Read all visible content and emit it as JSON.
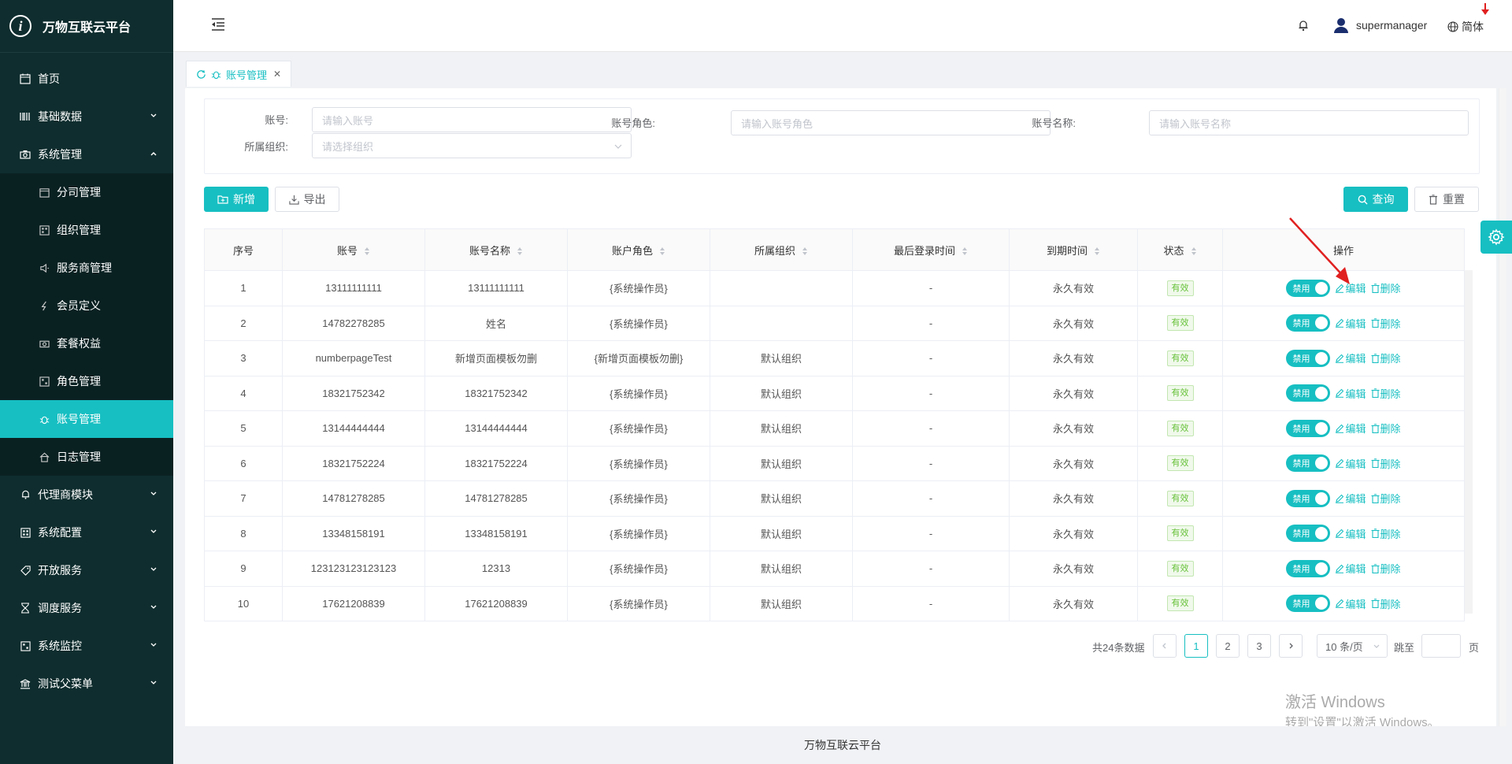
{
  "app": {
    "title": "万物互联云平台"
  },
  "sidebar": {
    "items": [
      {
        "label": "首页",
        "icon": "calendar-icon"
      },
      {
        "label": "基础数据",
        "icon": "barcode-icon"
      },
      {
        "label": "系统管理",
        "icon": "camera-icon"
      },
      {
        "label": "代理商模块",
        "icon": "bell-icon"
      },
      {
        "label": "系统配置",
        "icon": "grid-icon"
      },
      {
        "label": "开放服务",
        "icon": "tag-icon"
      },
      {
        "label": "调度服务",
        "icon": "hourglass-icon"
      },
      {
        "label": "系统监控",
        "icon": "grid-icon"
      },
      {
        "label": "测试父菜单",
        "icon": "bank-icon"
      }
    ],
    "sub_items": [
      {
        "label": "分司管理",
        "icon": "calendar-icon"
      },
      {
        "label": "组织管理",
        "icon": "grid-icon"
      },
      {
        "label": "服务商管理",
        "icon": "speaker-icon"
      },
      {
        "label": "会员定义",
        "icon": "bolt-icon"
      },
      {
        "label": "套餐权益",
        "icon": "camera-icon"
      },
      {
        "label": "角色管理",
        "icon": "grid-icon"
      },
      {
        "label": "账号管理",
        "icon": "bug-icon"
      },
      {
        "label": "日志管理",
        "icon": "home-icon"
      }
    ]
  },
  "topbar": {
    "user": "supermanager",
    "lang": "简体"
  },
  "tabs": [
    {
      "label": "账号管理"
    }
  ],
  "search": {
    "account_label": "账号:",
    "account_placeholder": "请输入账号",
    "role_label": "账号角色:",
    "role_placeholder": "请输入账号角色",
    "name_label": "账号名称:",
    "name_placeholder": "请输入账号名称",
    "org_label": "所属组织:",
    "org_placeholder": "请选择组织"
  },
  "toolbar": {
    "add": "新增",
    "export": "导出",
    "query": "查询",
    "reset": "重置"
  },
  "table": {
    "columns": [
      "序号",
      "账号",
      "账号名称",
      "账户角色",
      "所属组织",
      "最后登录时间",
      "到期时间",
      "状态",
      "操作"
    ],
    "rows": [
      {
        "no": "1",
        "account": "13111111111",
        "name": "13111111111",
        "role": "{系统操作员}",
        "org": "",
        "last_login": "-",
        "expire": "永久有效",
        "status": "有效"
      },
      {
        "no": "2",
        "account": "14782278285",
        "name": "姓名",
        "role": "{系统操作员}",
        "org": "",
        "last_login": "-",
        "expire": "永久有效",
        "status": "有效"
      },
      {
        "no": "3",
        "account": "numberpageTest",
        "name": "新增页面模板勿删",
        "role": "{新增页面模板勿删}",
        "org": "默认组织",
        "last_login": "-",
        "expire": "永久有效",
        "status": "有效"
      },
      {
        "no": "4",
        "account": "18321752342",
        "name": "18321752342",
        "role": "{系统操作员}",
        "org": "默认组织",
        "last_login": "-",
        "expire": "永久有效",
        "status": "有效"
      },
      {
        "no": "5",
        "account": "13144444444",
        "name": "13144444444",
        "role": "{系统操作员}",
        "org": "默认组织",
        "last_login": "-",
        "expire": "永久有效",
        "status": "有效"
      },
      {
        "no": "6",
        "account": "18321752224",
        "name": "18321752224",
        "role": "{系统操作员}",
        "org": "默认组织",
        "last_login": "-",
        "expire": "永久有效",
        "status": "有效"
      },
      {
        "no": "7",
        "account": "14781278285",
        "name": "14781278285",
        "role": "{系统操作员}",
        "org": "默认组织",
        "last_login": "-",
        "expire": "永久有效",
        "status": "有效"
      },
      {
        "no": "8",
        "account": "13348158191",
        "name": "13348158191",
        "role": "{系统操作员}",
        "org": "默认组织",
        "last_login": "-",
        "expire": "永久有效",
        "status": "有效"
      },
      {
        "no": "9",
        "account": "123123123123123",
        "name": "12313",
        "role": "{系统操作员}",
        "org": "默认组织",
        "last_login": "-",
        "expire": "永久有效",
        "status": "有效"
      },
      {
        "no": "10",
        "account": "17621208839",
        "name": "17621208839",
        "role": "{系统操作员}",
        "org": "默认组织",
        "last_login": "-",
        "expire": "永久有效",
        "status": "有效"
      }
    ],
    "toggle_label": "禁用",
    "edit_label": "编辑",
    "delete_label": "删除"
  },
  "pagination": {
    "total": "共24条数据",
    "pages": [
      "1",
      "2",
      "3"
    ],
    "current": "1",
    "page_size": "10 条/页",
    "jump_label": "跳至",
    "page_unit": "页"
  },
  "footer": {
    "text": "万物互联云平台"
  },
  "watermark": {
    "line1": "激活 Windows",
    "line2": "转到\"设置\"以激活 Windows。"
  },
  "colors": {
    "accent": "#17bfc2",
    "sidebar_bg": "#0f2d2e",
    "status_green": "#67c23a"
  }
}
